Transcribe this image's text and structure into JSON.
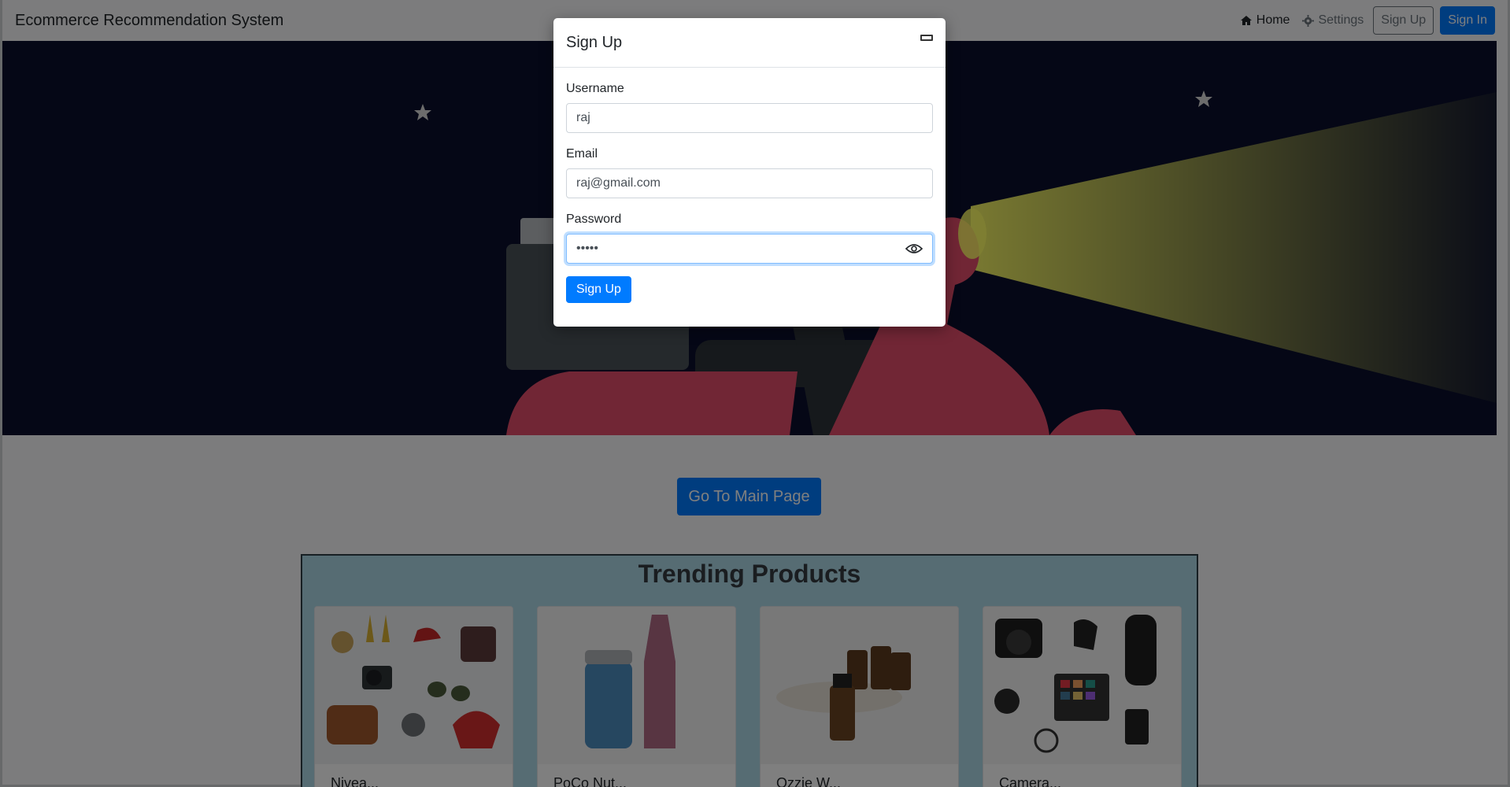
{
  "navbar": {
    "brand": "Ecommerce Recommendation System",
    "home_label": "Home",
    "settings_label": "Settings",
    "signup_label": "Sign Up",
    "signin_label": "Sign In"
  },
  "main": {
    "go_main_label": "Go To Main Page",
    "trending_title": "Trending Products",
    "products": [
      {
        "title": "Nivea...",
        "icon": "fashion-accessories-image"
      },
      {
        "title": "PoCo Nut...",
        "icon": "bottle-image"
      },
      {
        "title": "Ozzie W...",
        "icon": "cosmetics-bottles-image"
      },
      {
        "title": "Camera...",
        "icon": "camera-gear-image"
      }
    ]
  },
  "modal": {
    "title": "Sign Up",
    "username_label": "Username",
    "username_value": "raj",
    "email_label": "Email",
    "email_value": "raj@gmail.com",
    "password_label": "Password",
    "password_value": "•••••",
    "submit_label": "Sign Up"
  },
  "colors": {
    "primary": "#007bff",
    "navbar_bg": "#f8f9fa",
    "hero_bg": "#0a0f2c",
    "trending_bg": "#add8e6"
  }
}
